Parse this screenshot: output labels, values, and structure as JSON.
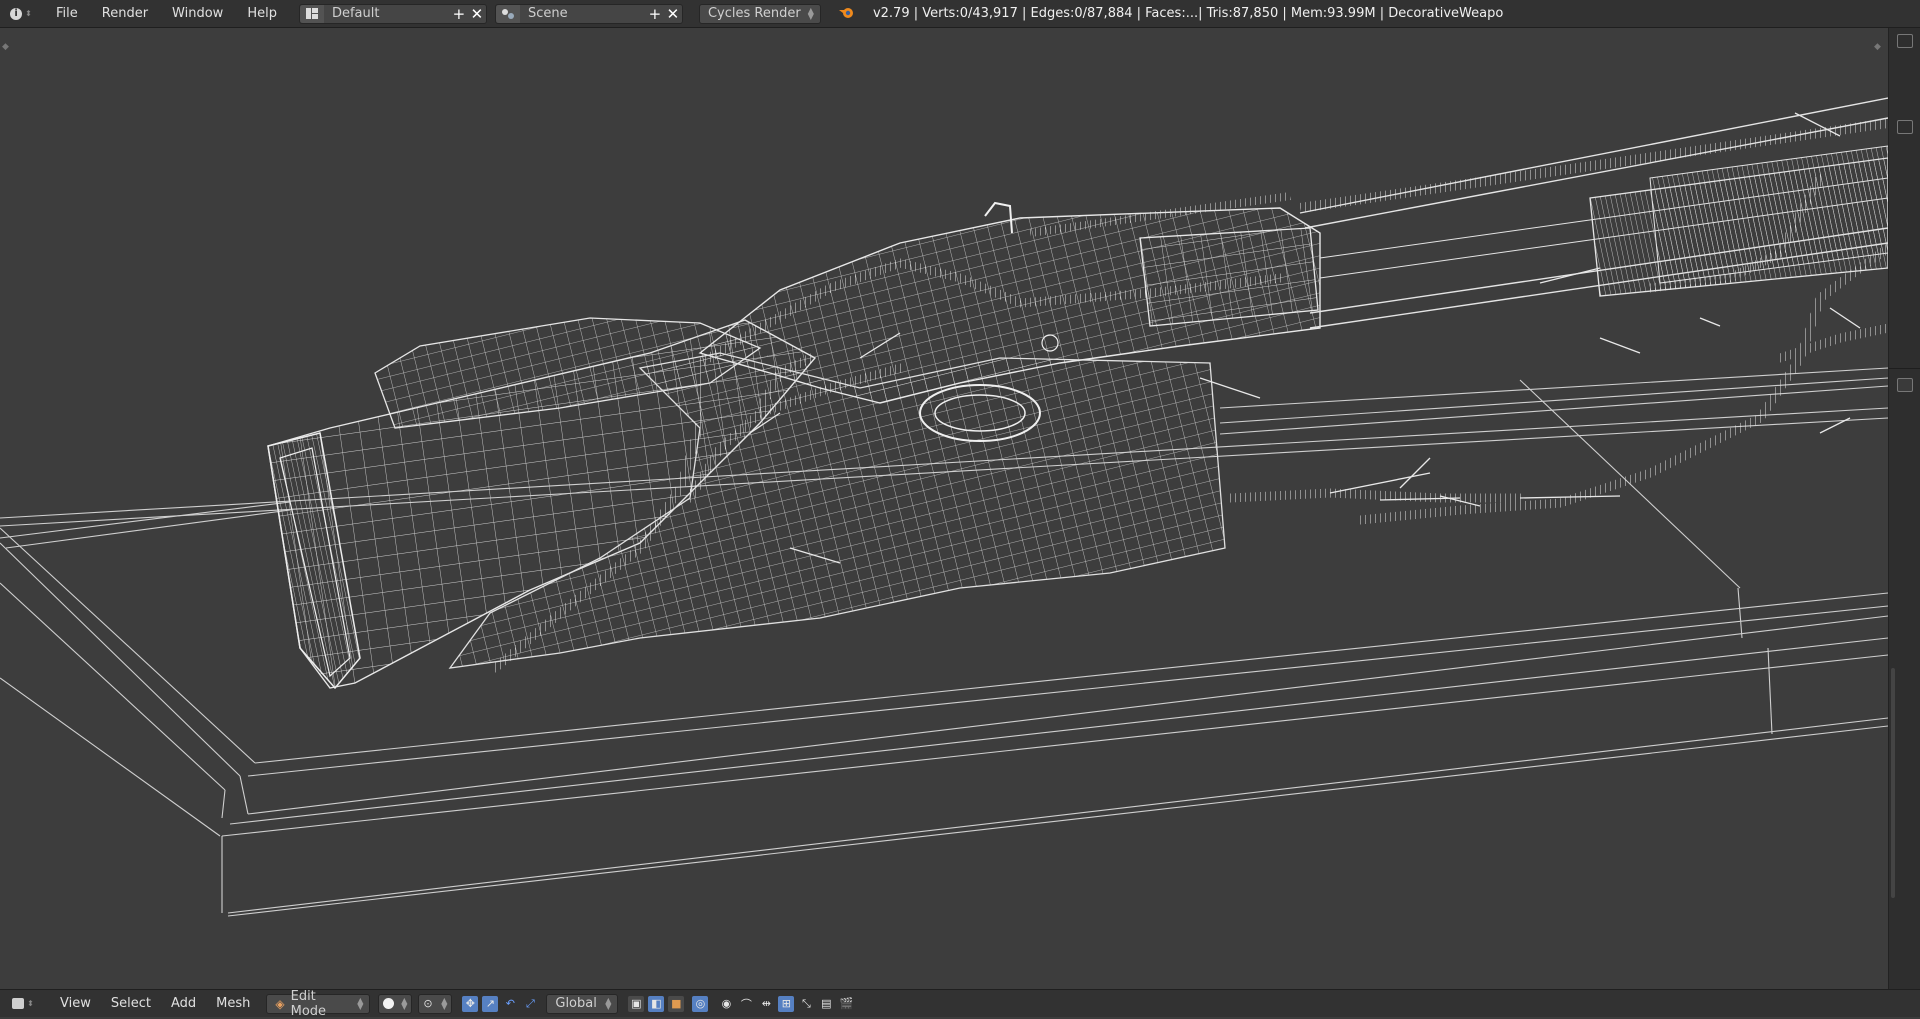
{
  "topbar": {
    "menus": [
      "File",
      "Render",
      "Window",
      "Help"
    ],
    "screen_layout": "Default",
    "scene": "Scene",
    "render_engine": "Cycles Render",
    "stats": "v2.79 | Verts:0/43,917 | Edges:0/87,884 | Faces:...| Tris:87,850 | Mem:93.99M | DecorativeWeapo"
  },
  "bottombar": {
    "menus": [
      "View",
      "Select",
      "Add",
      "Mesh"
    ],
    "mode": "Edit Mode",
    "orientation": "Global"
  },
  "icons": {
    "info": "info-icon",
    "layout": "screen-layout-icon",
    "scene": "scene-icon",
    "blender": "blender-logo-icon"
  },
  "colors": {
    "viewport_bg": "#3d3d3d",
    "wire": "#d8d8d8",
    "header_bg": "#323232",
    "accent": "#5680c2"
  }
}
